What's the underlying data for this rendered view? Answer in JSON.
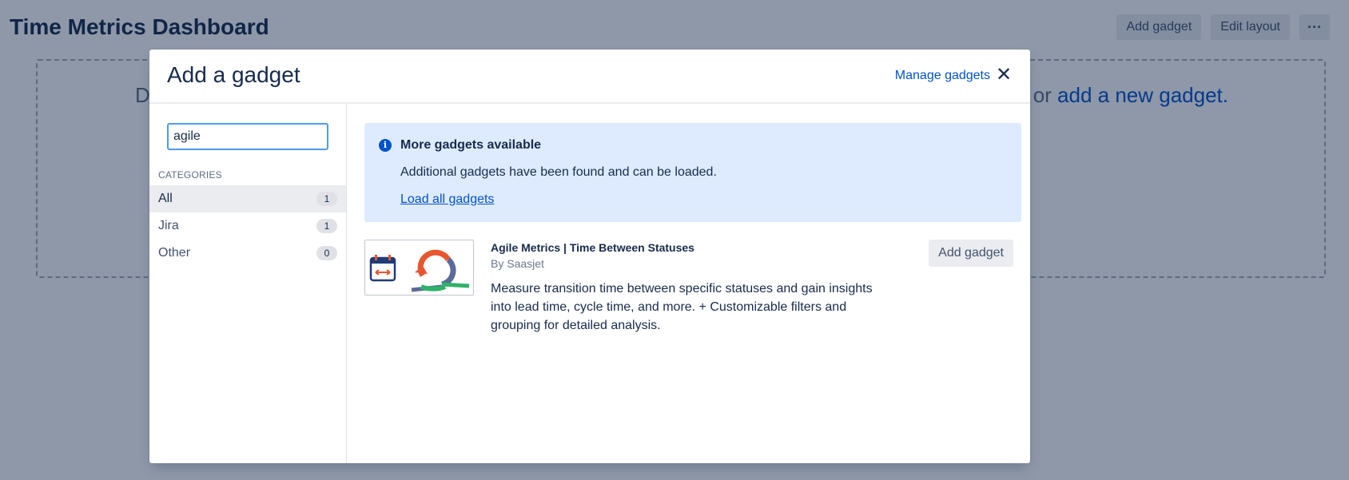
{
  "dashboard": {
    "title": "Time Metrics Dashboard",
    "add_gadget_label": "Add gadget",
    "edit_layout_label": "Edit layout",
    "more_label": "···",
    "drop_text_left": "D",
    "drop_text_right_prefix": "or ",
    "drop_text_right_link": "add a new gadget."
  },
  "modal": {
    "title": "Add a gadget",
    "manage_link": "Manage gadgets",
    "close_label": "✕",
    "search": {
      "value": "agile",
      "placeholder": ""
    },
    "categories_label": "CATEGORIES",
    "categories": [
      {
        "label": "All",
        "count": "1",
        "active": true
      },
      {
        "label": "Jira",
        "count": "1",
        "active": false
      },
      {
        "label": "Other",
        "count": "0",
        "active": false
      }
    ],
    "banner": {
      "title": "More gadgets available",
      "text": "Additional gadgets have been found and can be loaded.",
      "link": "Load all gadgets"
    },
    "gadget": {
      "title": "Agile Metrics | Time Between Statuses",
      "author": "By Saasjet",
      "description": "Measure transition time between specific statuses and gain insights into lead time, cycle time, and more. + Customizable filters and grouping for detailed analysis.",
      "add_label": "Add gadget"
    }
  },
  "colors": {
    "accent": "#0052cc",
    "banner_bg": "#deebff",
    "overlay": "#091e42"
  }
}
